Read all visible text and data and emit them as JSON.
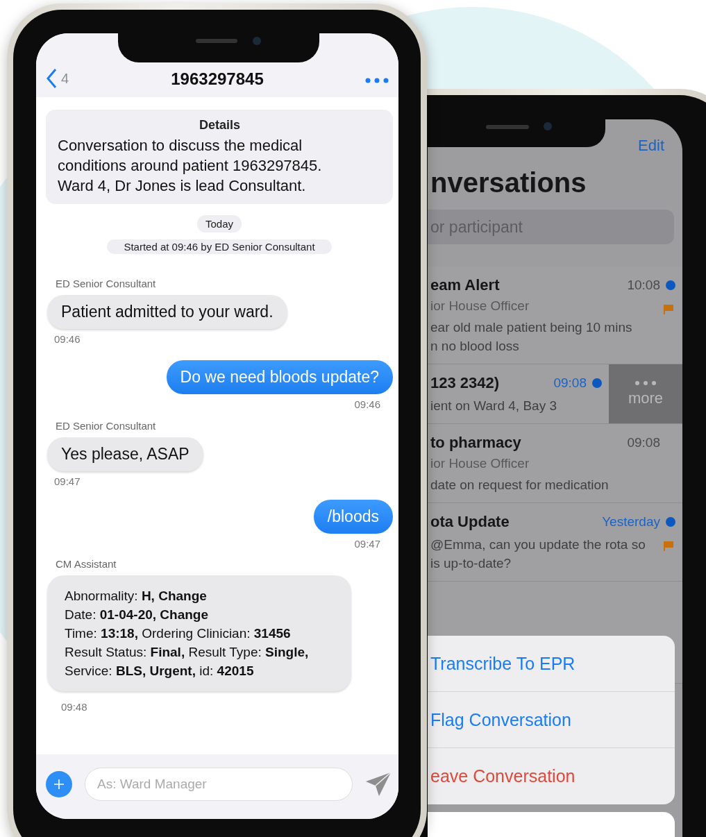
{
  "conversation": {
    "back_count": "4",
    "title": "1963297845",
    "details": {
      "heading": "Details",
      "text": "Conversation to discuss the medical conditions around patient 1963297845. Ward 4, Dr Jones is lead Consultant."
    },
    "day_label": "Today",
    "started_label": "Started at 09:46 by ED Senior Consultant",
    "messages": [
      {
        "kind": "incoming",
        "sender": "ED Senior Consultant",
        "text": "Patient admitted to your ward.",
        "time": "09:46"
      },
      {
        "kind": "outgoing",
        "text": "Do we need  bloods update?",
        "time": "09:46"
      },
      {
        "kind": "incoming",
        "sender": "ED Senior Consultant",
        "text": "Yes please, ASAP",
        "time": "09:47"
      },
      {
        "kind": "outgoing",
        "text": "/bloods",
        "time": "09:47"
      },
      {
        "kind": "result",
        "sender": "CM Assistant",
        "lines": [
          "Abnormality: **H, Change**",
          "Date: **01-04-20, Change**",
          "Time: **13:18,** Ordering Clinician: **31456**",
          "Result Status: **Final,** Result Type: **Single,**",
          "Service: **BLS, Urgent,** id: **42015**"
        ],
        "time": "09:48"
      }
    ],
    "composer": {
      "placeholder": "As: Ward Manager"
    }
  },
  "conversation_list": {
    "edit": "Edit",
    "title": "nversations",
    "search": {
      "placeholder": "or participant"
    },
    "rows": [
      {
        "title": "eam Alert",
        "time": "10:08",
        "time_accent": false,
        "unread": true,
        "flagged": true,
        "sender": "ior House Officer",
        "preview_lines": [
          "ear old male patient being 10 mins",
          "n no blood loss"
        ]
      },
      {
        "title": "123 2342)",
        "time": "09:08",
        "time_accent": true,
        "unread": true,
        "flagged": false,
        "preview_lines": [
          "ient on Ward 4, Bay 3"
        ],
        "swipe_action": "more"
      },
      {
        "title": "to pharmacy",
        "time": "09:08",
        "time_accent": false,
        "unread": false,
        "flagged": false,
        "sender": "ior House Officer",
        "preview_lines": [
          "date on request for medication"
        ]
      },
      {
        "title": "ota Update",
        "time": "Yesterday",
        "time_accent": true,
        "unread": true,
        "flagged": true,
        "preview_lines": [
          "@Emma, can you update the rota so",
          "is up-to-date?"
        ]
      }
    ],
    "action_sheet": {
      "actions": [
        {
          "label": "Transcribe To EPR",
          "kind": "default"
        },
        {
          "label": "Flag Conversation",
          "kind": "default"
        },
        {
          "label": "eave Conversation",
          "kind": "destructive"
        }
      ]
    }
  }
}
